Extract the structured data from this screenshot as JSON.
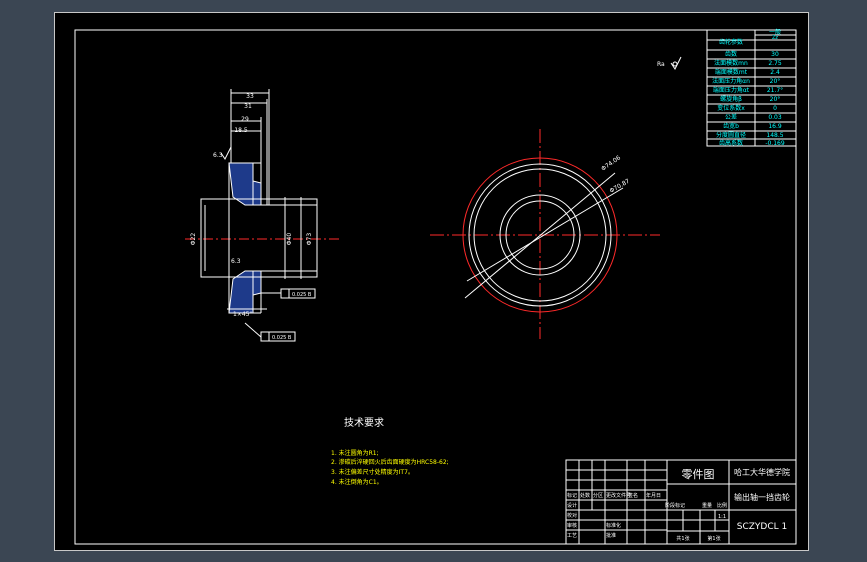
{
  "surface_mark": "Ra",
  "param_table": {
    "rows": [
      {
        "label": "齿轮参数",
        "value": "一般",
        "value2": "Zz"
      },
      {
        "label": "齿数",
        "value": "30"
      },
      {
        "label": "法面模数mn",
        "value": "2.75"
      },
      {
        "label": "端面模数mt",
        "value": "2.4"
      },
      {
        "label": "法面压力角αn",
        "value": "20°"
      },
      {
        "label": "端面压力角αt",
        "value": "21.7°"
      },
      {
        "label": "螺旋角β",
        "value": "20°"
      },
      {
        "label": "变位系数x",
        "value": "0"
      },
      {
        "label": "公差",
        "value": "0.03"
      },
      {
        "label": "齿宽b",
        "value": "16.9"
      },
      {
        "label": "分度圆直径",
        "value": "148.5"
      },
      {
        "label": "齿高系数",
        "value": "-0.169"
      }
    ]
  },
  "section_view": {
    "dims": [
      "33",
      "31",
      "29",
      "18.5",
      "Φ22",
      "Φ40",
      "Φ73"
    ],
    "tolerances": [
      "0.025 B",
      "0.025 B"
    ],
    "chamfer": "1×45°",
    "roughness": [
      "6.3",
      "6.3"
    ]
  },
  "front_view": {
    "dims": [
      "Φ74.06",
      "Φ70.87"
    ]
  },
  "tech_requirements": {
    "title": "技术要求",
    "items": [
      "1. 未注圆角为R1;",
      "2. 渗碳后淬硬回火后齿面硬度为HRC58-62;",
      "3. 未注偏差尺寸处精度为IT7。",
      "4. 未注倒角为C1。"
    ]
  },
  "title_block": {
    "drawing_type": "零件图",
    "school": "哈工大华德学院",
    "part_name": "输出轴一挡齿轮",
    "drawing_no": "SCZYDCL 1",
    "scale_label": "比例",
    "scale": "1:1",
    "weight_label": "重量",
    "stage_label": "阶段标记",
    "sheet_total": "共1张",
    "sheet_no": "第1张",
    "left_cells": [
      "标记",
      "处数",
      "分区",
      "更改文件号",
      "签名",
      "年月日",
      "设计",
      "校对",
      "审核",
      "工艺",
      "标准化",
      "批准"
    ]
  },
  "colors": {
    "canvas": "#000000",
    "frame": "#3b4653",
    "lines": "#ffffff",
    "center_lines": "#ff2a2a",
    "table_text": "#00ffff",
    "notes": "#ffff00",
    "gear_section": "#1e3a8a"
  }
}
